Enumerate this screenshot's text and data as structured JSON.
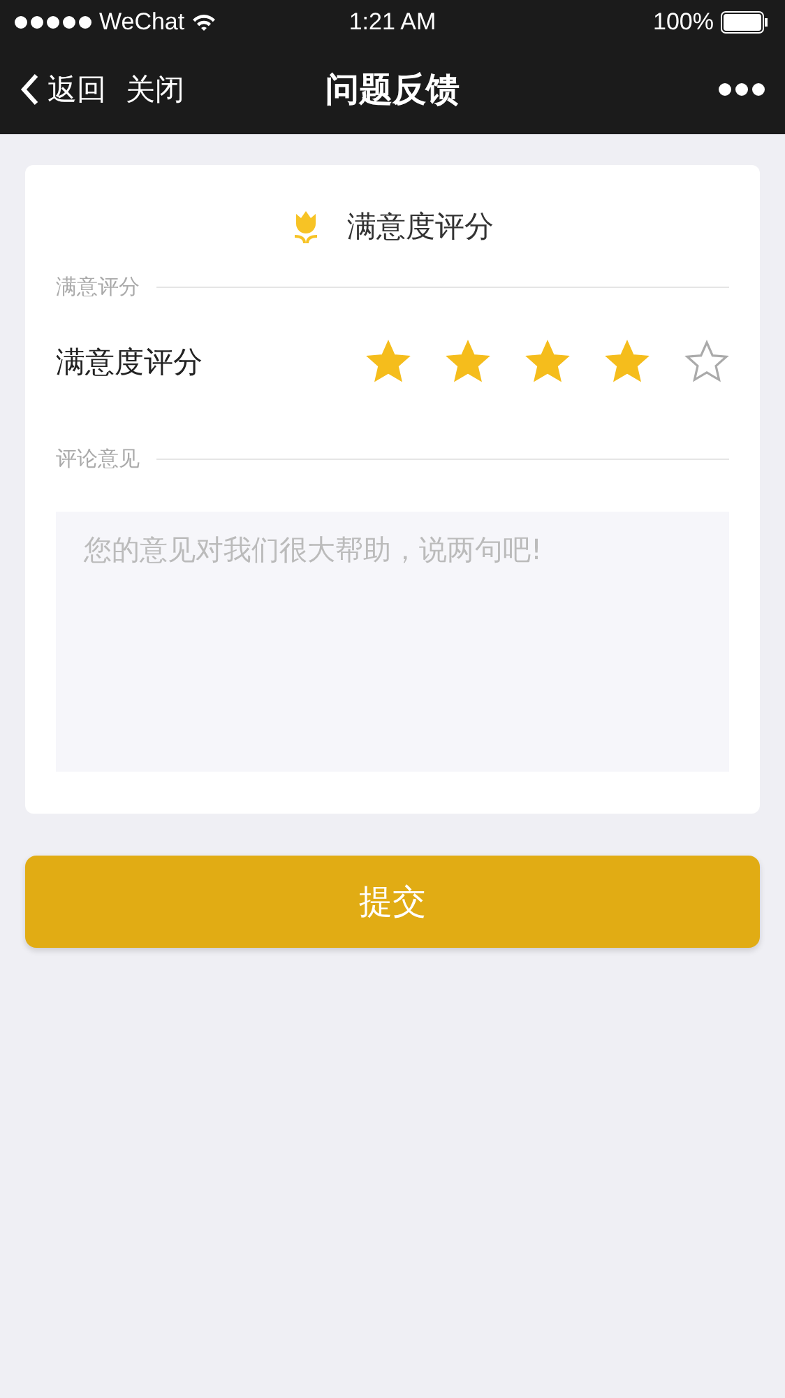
{
  "status_bar": {
    "carrier": "WeChat",
    "time": "1:21 AM",
    "battery": "100%"
  },
  "nav": {
    "back": "返回",
    "close": "关闭",
    "title": "问题反馈"
  },
  "card": {
    "title": "满意度评分",
    "rating_section": "满意评分",
    "rating_label": "满意度评分",
    "stars": 4,
    "comment_section": "评论意见",
    "comment_placeholder": "您的意见对我们很大帮助，说两句吧!"
  },
  "submit": "提交"
}
